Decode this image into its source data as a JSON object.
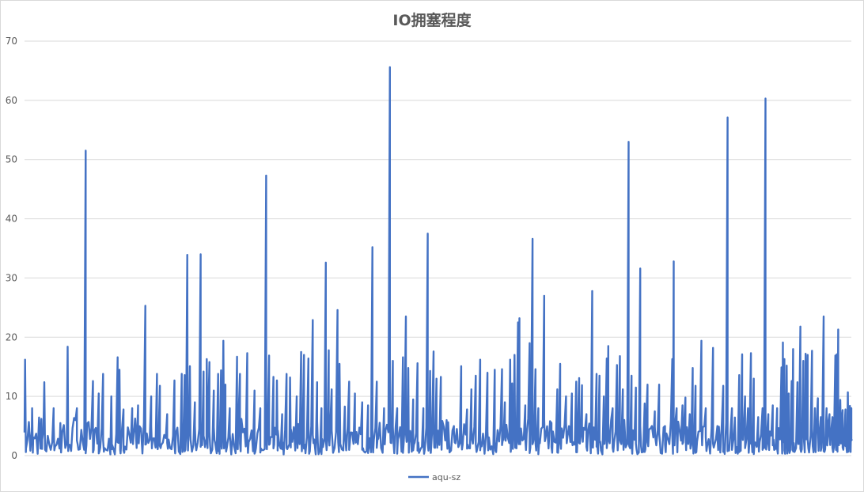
{
  "chart_data": {
    "type": "line",
    "title": "IO拥塞程度",
    "xlabel": "",
    "ylabel": "",
    "ylim": [
      0,
      70
    ],
    "y_ticks": [
      "0",
      "10",
      "20",
      "30",
      "40",
      "50",
      "60",
      "70"
    ],
    "grid": true,
    "legend_position": "bottom",
    "accent_color": "#4472c4",
    "grid_color": "#d9d9d9",
    "series": [
      {
        "name": "aqu-sz",
        "peaks": [
          [
            0.2,
            16.2
          ],
          [
            2.6,
            8.0
          ],
          [
            5.8,
            6.2
          ],
          [
            6.8,
            12.4
          ],
          [
            10.0,
            8.0
          ],
          [
            12.3,
            5.5
          ],
          [
            14.8,
            18.4
          ],
          [
            18.0,
            8.0
          ],
          [
            21.0,
            51.5
          ],
          [
            23.5,
            12.6
          ],
          [
            25.5,
            10.5
          ],
          [
            27.0,
            13.8
          ],
          [
            29.8,
            10.0
          ],
          [
            32.0,
            16.6
          ],
          [
            32.6,
            14.5
          ],
          [
            34.0,
            7.8
          ],
          [
            37.0,
            8.0
          ],
          [
            39.0,
            8.5
          ],
          [
            41.5,
            25.3
          ],
          [
            43.5,
            10.0
          ],
          [
            45.5,
            13.8
          ],
          [
            46.5,
            11.8
          ],
          [
            49.0,
            7.0
          ],
          [
            51.5,
            12.7
          ],
          [
            54.0,
            13.8
          ],
          [
            55.0,
            13.6
          ],
          [
            55.9,
            33.9
          ],
          [
            56.8,
            15.1
          ],
          [
            58.5,
            9.0
          ],
          [
            60.5,
            34.0
          ],
          [
            61.5,
            14.2
          ],
          [
            62.6,
            16.3
          ],
          [
            63.5,
            15.8
          ],
          [
            65.0,
            11.0
          ],
          [
            66.5,
            13.8
          ],
          [
            67.5,
            14.4
          ],
          [
            68.3,
            19.4
          ],
          [
            69.0,
            12.0
          ],
          [
            70.5,
            8.0
          ],
          [
            73.0,
            16.7
          ],
          [
            74.0,
            13.8
          ],
          [
            76.5,
            17.3
          ],
          [
            79.0,
            11.0
          ],
          [
            81.0,
            8.0
          ],
          [
            83.0,
            47.3
          ],
          [
            84.0,
            16.9
          ],
          [
            85.5,
            13.3
          ],
          [
            86.7,
            12.7
          ],
          [
            88.5,
            7.0
          ],
          [
            90.0,
            13.8
          ],
          [
            91.2,
            13.2
          ],
          [
            93.5,
            10.0
          ],
          [
            95.0,
            17.5
          ],
          [
            96.0,
            17.0
          ],
          [
            97.5,
            16.4
          ],
          [
            99.0,
            22.9
          ],
          [
            100.5,
            12.4
          ],
          [
            102.0,
            8.0
          ],
          [
            103.5,
            32.6
          ],
          [
            104.5,
            17.8
          ],
          [
            105.5,
            11.2
          ],
          [
            107.5,
            24.6
          ],
          [
            108.2,
            15.5
          ],
          [
            110.0,
            8.3
          ],
          [
            111.5,
            12.5
          ],
          [
            113.5,
            10.5
          ],
          [
            116.0,
            9.0
          ],
          [
            118.0,
            8.5
          ],
          [
            119.5,
            35.2
          ],
          [
            121.0,
            12.5
          ],
          [
            123.5,
            8.0
          ],
          [
            125.5,
            65.6
          ],
          [
            126.5,
            16.0
          ],
          [
            128.0,
            8.0
          ],
          [
            130.0,
            16.6
          ],
          [
            131.0,
            23.5
          ],
          [
            131.8,
            14.8
          ],
          [
            133.5,
            9.5
          ],
          [
            135.0,
            15.6
          ],
          [
            137.0,
            8.0
          ],
          [
            138.5,
            37.5
          ],
          [
            139.3,
            14.3
          ],
          [
            140.5,
            17.6
          ],
          [
            141.5,
            13.0
          ],
          [
            143.0,
            13.3
          ],
          [
            145.0,
            6.0
          ],
          [
            147.5,
            5.0
          ],
          [
            150.0,
            15.1
          ],
          [
            152.0,
            7.8
          ],
          [
            153.5,
            11.2
          ],
          [
            155.0,
            13.5
          ],
          [
            156.5,
            16.2
          ],
          [
            159.0,
            14.0
          ],
          [
            161.5,
            14.5
          ],
          [
            164.0,
            14.6
          ],
          [
            165.0,
            9.0
          ],
          [
            166.8,
            16.2
          ],
          [
            167.5,
            12.2
          ],
          [
            168.3,
            17.0
          ],
          [
            169.5,
            22.5
          ],
          [
            170.0,
            23.2
          ],
          [
            172.0,
            8.5
          ],
          [
            173.5,
            19.0
          ],
          [
            174.5,
            36.6
          ],
          [
            175.5,
            14.6
          ],
          [
            176.5,
            8.0
          ],
          [
            178.5,
            27.0
          ],
          [
            181.0,
            5.5
          ],
          [
            183.0,
            11.2
          ],
          [
            184.0,
            15.5
          ],
          [
            186.0,
            10.0
          ],
          [
            188.0,
            10.5
          ],
          [
            189.5,
            12.5
          ],
          [
            190.5,
            13.1
          ],
          [
            191.5,
            11.9
          ],
          [
            193.0,
            7.0
          ],
          [
            195.0,
            27.8
          ],
          [
            196.5,
            13.8
          ],
          [
            197.5,
            13.5
          ],
          [
            199.0,
            10.0
          ],
          [
            200.0,
            16.4
          ],
          [
            200.5,
            18.5
          ],
          [
            202.0,
            8.0
          ],
          [
            203.5,
            15.3
          ],
          [
            204.5,
            16.8
          ],
          [
            205.5,
            11.2
          ],
          [
            207.5,
            53.0
          ],
          [
            208.5,
            13.5
          ],
          [
            210.0,
            11.5
          ],
          [
            211.5,
            31.6
          ],
          [
            213.0,
            8.8
          ],
          [
            214.0,
            12.0
          ],
          [
            216.5,
            7.5
          ],
          [
            218.0,
            12.0
          ],
          [
            220.0,
            5.0
          ],
          [
            222.5,
            16.3
          ],
          [
            223.0,
            32.8
          ],
          [
            224.0,
            8.0
          ],
          [
            226.0,
            8.5
          ],
          [
            227.0,
            9.8
          ],
          [
            228.5,
            7.0
          ],
          [
            229.5,
            14.8
          ],
          [
            230.5,
            11.8
          ],
          [
            232.5,
            19.4
          ],
          [
            234.0,
            8.0
          ],
          [
            236.5,
            18.2
          ],
          [
            238.0,
            5.0
          ],
          [
            240.0,
            11.8
          ],
          [
            241.5,
            57.1
          ],
          [
            243.0,
            8.0
          ],
          [
            244.0,
            6.0
          ],
          [
            245.5,
            13.6
          ],
          [
            246.5,
            17.1
          ],
          [
            247.5,
            10.0
          ],
          [
            248.5,
            8.0
          ],
          [
            249.5,
            17.3
          ],
          [
            250.5,
            13.0
          ],
          [
            252.0,
            6.5
          ],
          [
            253.5,
            8.0
          ],
          [
            254.5,
            60.3
          ],
          [
            255.5,
            7.0
          ],
          [
            257.0,
            8.5
          ],
          [
            258.5,
            8.0
          ],
          [
            260.0,
            14.9
          ],
          [
            260.5,
            19.1
          ],
          [
            261.0,
            16.3
          ],
          [
            261.8,
            15.2
          ],
          [
            262.5,
            10.5
          ],
          [
            263.5,
            12.6
          ],
          [
            264.0,
            18.0
          ],
          [
            265.5,
            12.4
          ],
          [
            266.5,
            21.8
          ],
          [
            267.5,
            16.0
          ],
          [
            268.3,
            17.2
          ],
          [
            269.0,
            17.0
          ],
          [
            270.5,
            17.7
          ],
          [
            271.5,
            8.0
          ],
          [
            272.5,
            9.7
          ],
          [
            273.5,
            6.5
          ],
          [
            274.5,
            23.5
          ],
          [
            275.5,
            8.0
          ],
          [
            276.5,
            7.0
          ],
          [
            277.5,
            6.5
          ],
          [
            278.5,
            16.9
          ],
          [
            279.0,
            17.1
          ],
          [
            279.5,
            21.3
          ],
          [
            280.2,
            9.4
          ],
          [
            281.0,
            7.7
          ],
          [
            282.0,
            7.8
          ],
          [
            282.8,
            10.7
          ],
          [
            283.5,
            8.4
          ],
          [
            284.0,
            8.0
          ]
        ]
      }
    ]
  }
}
